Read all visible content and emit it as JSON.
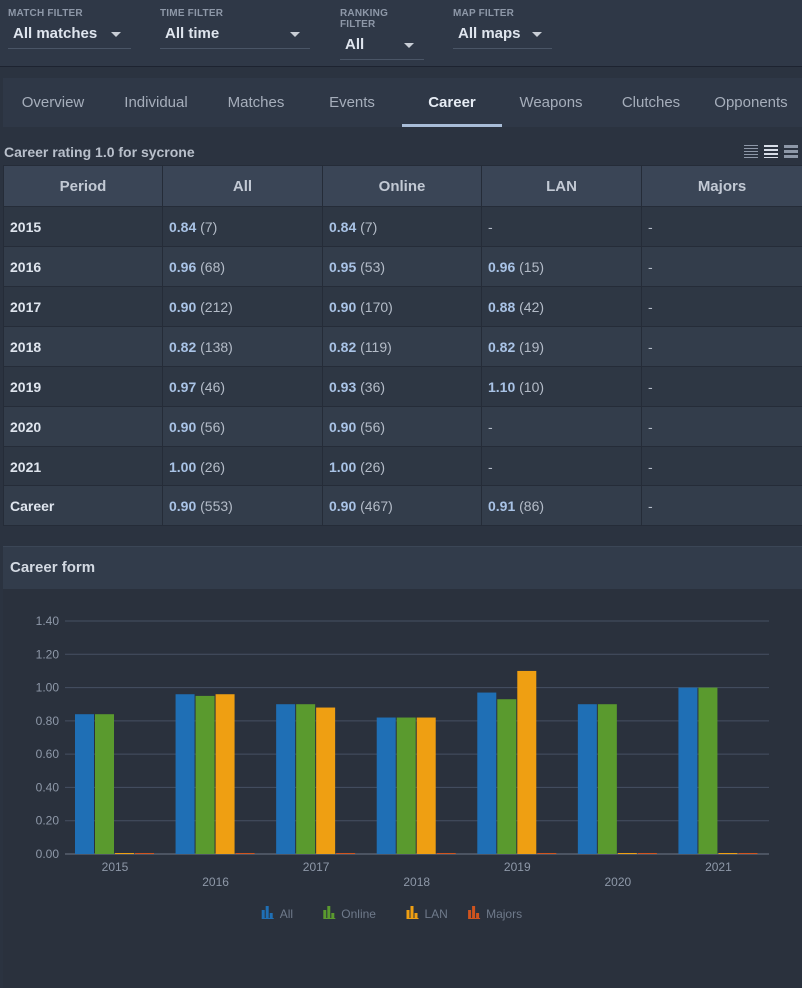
{
  "filters": [
    {
      "label": "MATCH FILTER",
      "value": "All matches"
    },
    {
      "label": "TIME FILTER",
      "value": "All time"
    },
    {
      "label": "RANKING FILTER",
      "value": "All"
    },
    {
      "label": "MAP FILTER",
      "value": "All maps"
    }
  ],
  "tabs": [
    "Overview",
    "Individual",
    "Matches",
    "Events",
    "Career",
    "Weapons",
    "Clutches",
    "Opponents"
  ],
  "active_tab": "Career",
  "table_section": {
    "title": "Career rating 1.0 for sycrone",
    "view_icons": [
      "list-compact-icon",
      "list-medium-icon",
      "list-wide-icon"
    ]
  },
  "table": {
    "headers": [
      "Period",
      "All",
      "Online",
      "LAN",
      "Majors"
    ],
    "rows": [
      {
        "period": "2015",
        "all": {
          "r": "0.84",
          "n": "(7)"
        },
        "online": {
          "r": "0.84",
          "n": "(7)"
        },
        "lan": {
          "r": "-",
          "n": ""
        },
        "majors": {
          "r": "-",
          "n": ""
        }
      },
      {
        "period": "2016",
        "all": {
          "r": "0.96",
          "n": "(68)"
        },
        "online": {
          "r": "0.95",
          "n": "(53)"
        },
        "lan": {
          "r": "0.96",
          "n": "(15)"
        },
        "majors": {
          "r": "-",
          "n": ""
        }
      },
      {
        "period": "2017",
        "all": {
          "r": "0.90",
          "n": "(212)"
        },
        "online": {
          "r": "0.90",
          "n": "(170)"
        },
        "lan": {
          "r": "0.88",
          "n": "(42)"
        },
        "majors": {
          "r": "-",
          "n": ""
        }
      },
      {
        "period": "2018",
        "all": {
          "r": "0.82",
          "n": "(138)"
        },
        "online": {
          "r": "0.82",
          "n": "(119)"
        },
        "lan": {
          "r": "0.82",
          "n": "(19)"
        },
        "majors": {
          "r": "-",
          "n": ""
        }
      },
      {
        "period": "2019",
        "all": {
          "r": "0.97",
          "n": "(46)"
        },
        "online": {
          "r": "0.93",
          "n": "(36)"
        },
        "lan": {
          "r": "1.10",
          "n": "(10)"
        },
        "majors": {
          "r": "-",
          "n": ""
        }
      },
      {
        "period": "2020",
        "all": {
          "r": "0.90",
          "n": "(56)"
        },
        "online": {
          "r": "0.90",
          "n": "(56)"
        },
        "lan": {
          "r": "-",
          "n": ""
        },
        "majors": {
          "r": "-",
          "n": ""
        }
      },
      {
        "period": "2021",
        "all": {
          "r": "1.00",
          "n": "(26)"
        },
        "online": {
          "r": "1.00",
          "n": "(26)"
        },
        "lan": {
          "r": "-",
          "n": ""
        },
        "majors": {
          "r": "-",
          "n": ""
        }
      }
    ],
    "total": {
      "period": "Career",
      "all": {
        "r": "0.90",
        "n": "(553)"
      },
      "online": {
        "r": "0.90",
        "n": "(467)"
      },
      "lan": {
        "r": "0.91",
        "n": "(86)"
      },
      "majors": {
        "r": "-",
        "n": ""
      }
    }
  },
  "chart_section": {
    "title": "Career form"
  },
  "chart_data": {
    "type": "bar",
    "title": "Career form",
    "xlabel": "",
    "ylabel": "",
    "categories": [
      "2015",
      "2016",
      "2017",
      "2018",
      "2019",
      "2020",
      "2021"
    ],
    "ylim": [
      0,
      1.4
    ],
    "yticks": [
      "0.00",
      "0.20",
      "0.40",
      "0.60",
      "0.80",
      "1.00",
      "1.20",
      "1.40"
    ],
    "grid": true,
    "legend": "bottom-center",
    "series": [
      {
        "name": "All",
        "color": "#1f6fb5",
        "values": [
          0.84,
          0.96,
          0.9,
          0.82,
          0.97,
          0.9,
          1.0
        ]
      },
      {
        "name": "Online",
        "color": "#5a9a2e",
        "values": [
          0.84,
          0.95,
          0.9,
          0.82,
          0.93,
          0.9,
          1.0
        ]
      },
      {
        "name": "LAN",
        "color": "#ef9f12",
        "values": [
          0,
          0.96,
          0.88,
          0.82,
          1.1,
          0,
          0
        ]
      },
      {
        "name": "Majors",
        "color": "#d0541e",
        "values": [
          0,
          0,
          0,
          0,
          0,
          0,
          0
        ]
      }
    ]
  }
}
